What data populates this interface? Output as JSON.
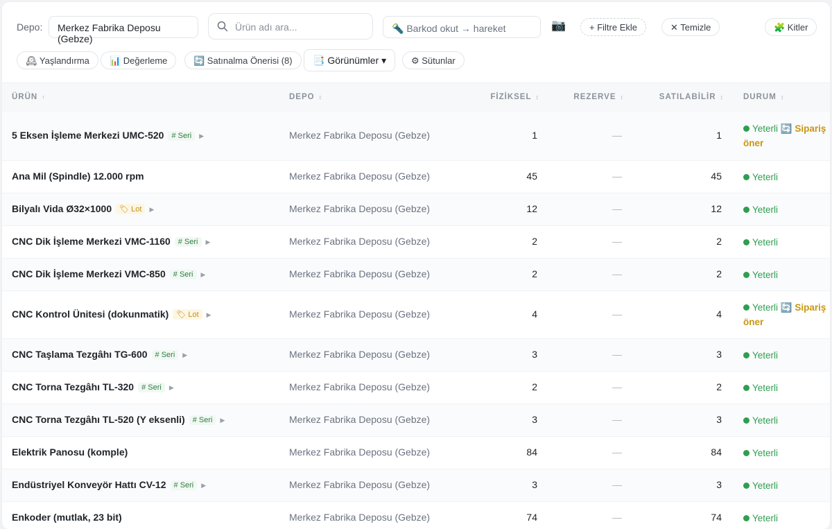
{
  "toolbar": {
    "depo_label": "Depo:",
    "depo_selected": "Merkez Fabrika Deposu (Gebze)",
    "search_placeholder": "Ürün adı ara...",
    "barcode_placeholder": "🔦 Barkod okut → hareket",
    "camera_icon": "📷",
    "add_filter": "+ Filtre Ekle",
    "clear": "✕ Temizle",
    "kits": "🧩 Kitler"
  },
  "toolbar2": {
    "aging": "🕰 Yaşlandırma",
    "valuation": "📊 Değerleme",
    "purchase_suggestion": "🔄 Satınalma Önerisi (8)",
    "views": "📑 Görünümler ▾",
    "columns": "⚙ Sütunlar"
  },
  "table": {
    "headers": {
      "product": "ÜRÜN",
      "depo": "DEPO",
      "physical": "FİZİKSEL",
      "reserved": "REZERVE",
      "available": "SATILABİLİR",
      "status": "DURUM"
    },
    "sort_icon_active": "↑",
    "sort_icon": "↕",
    "rows": [
      {
        "name": "5 Eksen İşleme Merkezi UMC-520",
        "tag": "# Seri",
        "tag_type": "seri",
        "depo": "Merkez Fabrika Deposu (Gebze)",
        "physical": "1",
        "reserved": "—",
        "available": "1",
        "status": "Yeterli",
        "suggest": "🔄 Sipariş öner"
      },
      {
        "name": "Ana Mil (Spindle) 12.000 rpm",
        "tag": "",
        "tag_type": "",
        "depo": "Merkez Fabrika Deposu (Gebze)",
        "physical": "45",
        "reserved": "—",
        "available": "45",
        "status": "Yeterli",
        "suggest": ""
      },
      {
        "name": "Bilyalı Vida Ø32×1000",
        "tag": "🏷 Lot",
        "tag_type": "lot",
        "depo": "Merkez Fabrika Deposu (Gebze)",
        "physical": "12",
        "reserved": "—",
        "available": "12",
        "status": "Yeterli",
        "suggest": ""
      },
      {
        "name": "CNC Dik İşleme Merkezi VMC-1160",
        "tag": "# Seri",
        "tag_type": "seri",
        "depo": "Merkez Fabrika Deposu (Gebze)",
        "physical": "2",
        "reserved": "—",
        "available": "2",
        "status": "Yeterli",
        "suggest": ""
      },
      {
        "name": "CNC Dik İşleme Merkezi VMC-850",
        "tag": "# Seri",
        "tag_type": "seri",
        "depo": "Merkez Fabrika Deposu (Gebze)",
        "physical": "2",
        "reserved": "—",
        "available": "2",
        "status": "Yeterli",
        "suggest": ""
      },
      {
        "name": "CNC Kontrol Ünitesi (dokunmatik)",
        "tag": "🏷 Lot",
        "tag_type": "lot",
        "depo": "Merkez Fabrika Deposu (Gebze)",
        "physical": "4",
        "reserved": "—",
        "available": "4",
        "status": "Yeterli",
        "suggest": "🔄 Sipariş öner"
      },
      {
        "name": "CNC Taşlama Tezgâhı TG-600",
        "tag": "# Seri",
        "tag_type": "seri",
        "depo": "Merkez Fabrika Deposu (Gebze)",
        "physical": "3",
        "reserved": "—",
        "available": "3",
        "status": "Yeterli",
        "suggest": ""
      },
      {
        "name": "CNC Torna Tezgâhı TL-320",
        "tag": "# Seri",
        "tag_type": "seri",
        "depo": "Merkez Fabrika Deposu (Gebze)",
        "physical": "2",
        "reserved": "—",
        "available": "2",
        "status": "Yeterli",
        "suggest": ""
      },
      {
        "name": "CNC Torna Tezgâhı TL-520 (Y eksenli)",
        "tag": "# Seri",
        "tag_type": "seri",
        "depo": "Merkez Fabrika Deposu (Gebze)",
        "physical": "3",
        "reserved": "—",
        "available": "3",
        "status": "Yeterli",
        "suggest": ""
      },
      {
        "name": "Elektrik Panosu (komple)",
        "tag": "",
        "tag_type": "",
        "depo": "Merkez Fabrika Deposu (Gebze)",
        "physical": "84",
        "reserved": "—",
        "available": "84",
        "status": "Yeterli",
        "suggest": ""
      },
      {
        "name": "Endüstriyel Konveyör Hattı CV-12",
        "tag": "# Seri",
        "tag_type": "seri",
        "depo": "Merkez Fabrika Deposu (Gebze)",
        "physical": "3",
        "reserved": "—",
        "available": "3",
        "status": "Yeterli",
        "suggest": ""
      },
      {
        "name": "Enkoder (mutlak, 23 bit)",
        "tag": "",
        "tag_type": "",
        "depo": "Merkez Fabrika Deposu (Gebze)",
        "physical": "74",
        "reserved": "—",
        "available": "74",
        "status": "Yeterli",
        "suggest": ""
      }
    ]
  },
  "colors": {
    "ok": "#2f9e50",
    "suggest": "#c79613",
    "seri_tag": "#2f7d42",
    "lot_tag": "#c2901a"
  }
}
